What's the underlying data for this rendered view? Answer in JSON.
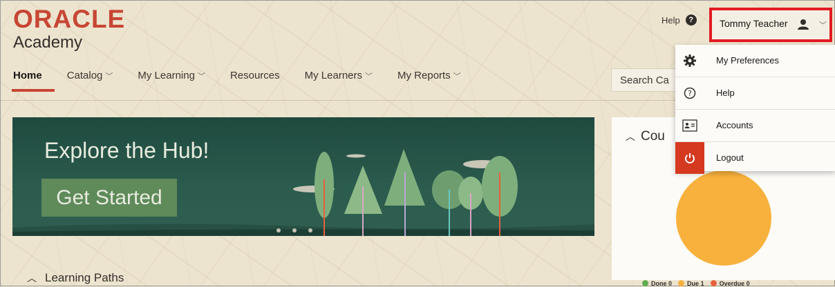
{
  "logo": {
    "brand": "ORACLE",
    "product": "Academy"
  },
  "nav": {
    "items": [
      {
        "label": "Home",
        "active": true,
        "has_dropdown": false
      },
      {
        "label": "Catalog",
        "has_dropdown": true
      },
      {
        "label": "My Learning",
        "has_dropdown": true
      },
      {
        "label": "Resources",
        "has_dropdown": false
      },
      {
        "label": "My Learners",
        "has_dropdown": true
      },
      {
        "label": "My Reports",
        "has_dropdown": true
      }
    ]
  },
  "search": {
    "visible_text": "Search Ca"
  },
  "header": {
    "help_label": "Help",
    "help_icon": "question-circle-icon"
  },
  "user": {
    "name": "Tommy Teacher",
    "icon": "user-icon",
    "highlight_color": "#e21b22"
  },
  "user_menu": {
    "items": [
      {
        "label": "My Preferences",
        "icon": "gear-icon"
      },
      {
        "label": "Help",
        "icon": "question-circle-icon"
      },
      {
        "label": "Accounts",
        "icon": "id-card-icon"
      },
      {
        "label": "Logout",
        "icon": "power-icon"
      }
    ]
  },
  "banner": {
    "title": "Explore the Hub!",
    "cta": "Get Started",
    "slides": 3,
    "active_slide": 1
  },
  "learning_paths": {
    "label": "Learning Paths"
  },
  "course_card": {
    "title_visible": "Cou",
    "legend": [
      {
        "label": "Done",
        "count": "0",
        "color": "#5fae4e"
      },
      {
        "label": "Due",
        "count": "1",
        "color": "#f7b13c"
      },
      {
        "label": "Overdue",
        "count": "0",
        "color": "#e8603c"
      }
    ]
  },
  "colors": {
    "brand_red": "#c74634",
    "banner_green": "#2b5c4e",
    "pie_orange": "#f7b13c"
  },
  "chart_data": {
    "type": "pie",
    "categories": [
      "Done",
      "Due",
      "Overdue"
    ],
    "values": [
      0,
      1,
      0
    ],
    "title": ""
  }
}
